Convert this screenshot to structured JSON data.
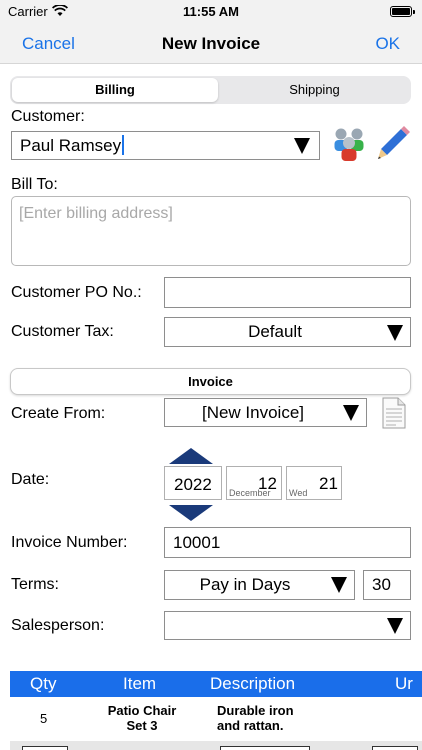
{
  "status_bar": {
    "carrier": "Carrier",
    "time": "11:55 AM"
  },
  "nav": {
    "cancel_label": "Cancel",
    "title": "New Invoice",
    "ok_label": "OK"
  },
  "tabs": [
    {
      "label": "Billing",
      "selected": true
    },
    {
      "label": "Shipping",
      "selected": false
    }
  ],
  "billing": {
    "customer_label": "Customer:",
    "customer_value": "Paul Ramsey",
    "bill_to_label": "Bill To:",
    "bill_to_placeholder": "[Enter billing address]",
    "customer_po_label": "Customer PO No.:",
    "customer_po_value": "",
    "customer_tax_label": "Customer Tax:",
    "customer_tax_value": "Default"
  },
  "invoice": {
    "section_label": "Invoice",
    "create_from_label": "Create From:",
    "create_from_value": "[New Invoice]",
    "date_label": "Date:",
    "date": {
      "year": "2022",
      "month_day": "12",
      "month_name": "December",
      "day": "21",
      "weekday": "Wed"
    },
    "invoice_number_label": "Invoice Number:",
    "invoice_number_value": "10001",
    "terms_label": "Terms:",
    "terms_value": "Pay in Days",
    "terms_days": "30",
    "salesperson_label": "Salesperson:",
    "salesperson_value": ""
  },
  "table": {
    "columns": [
      "Qty",
      "Item",
      "Description",
      "Ur"
    ],
    "rows": [
      {
        "qty": "5",
        "item": "Patio Chair Set 3",
        "description": "Durable iron and rattan."
      }
    ]
  },
  "colors": {
    "accent": "#1a73e8",
    "table_header": "#1a6eea",
    "stepper_arrow": "#1a3a7a"
  },
  "icons": [
    "wifi-icon",
    "battery-icon",
    "customers-icon",
    "pencil-icon",
    "document-icon"
  ]
}
